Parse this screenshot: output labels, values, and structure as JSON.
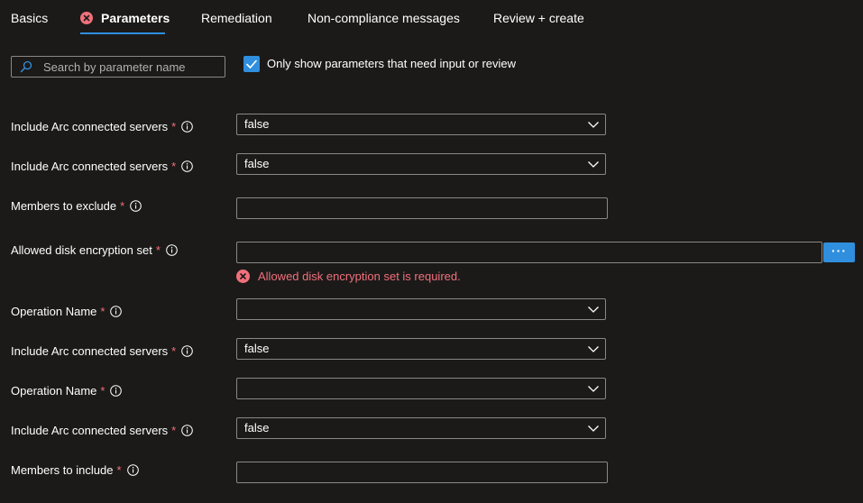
{
  "tabs": [
    {
      "label": "Basics"
    },
    {
      "label": "Parameters",
      "has_error": true,
      "active": true
    },
    {
      "label": "Remediation"
    },
    {
      "label": "Non-compliance messages"
    },
    {
      "label": "Review + create"
    }
  ],
  "search": {
    "placeholder": "Search by parameter name",
    "value": ""
  },
  "filter": {
    "label": "Only show parameters that need input or review",
    "checked": true
  },
  "params": [
    {
      "label": "Include Arc connected servers",
      "required": "*",
      "value": "false"
    },
    {
      "label": "Include Arc connected servers",
      "required": "*",
      "value": "false"
    },
    {
      "label": "Members to exclude",
      "required": "*",
      "value": ""
    },
    {
      "label": "Allowed disk encryption set",
      "required": "*",
      "value": "",
      "button_label": "···",
      "error": "Allowed disk encryption set is required."
    },
    {
      "label": "Operation Name",
      "required": "*",
      "value": ""
    },
    {
      "label": "Include Arc connected servers",
      "required": "*",
      "value": "false"
    },
    {
      "label": "Operation Name",
      "required": "*",
      "value": ""
    },
    {
      "label": "Include Arc connected servers",
      "required": "*",
      "value": "false"
    },
    {
      "label": "Members to include",
      "required": "*",
      "value": ""
    }
  ],
  "colors": {
    "accent": "#2f8fde",
    "error": "#f1707b",
    "background": "#1b1a19",
    "border": "#8a8886"
  }
}
